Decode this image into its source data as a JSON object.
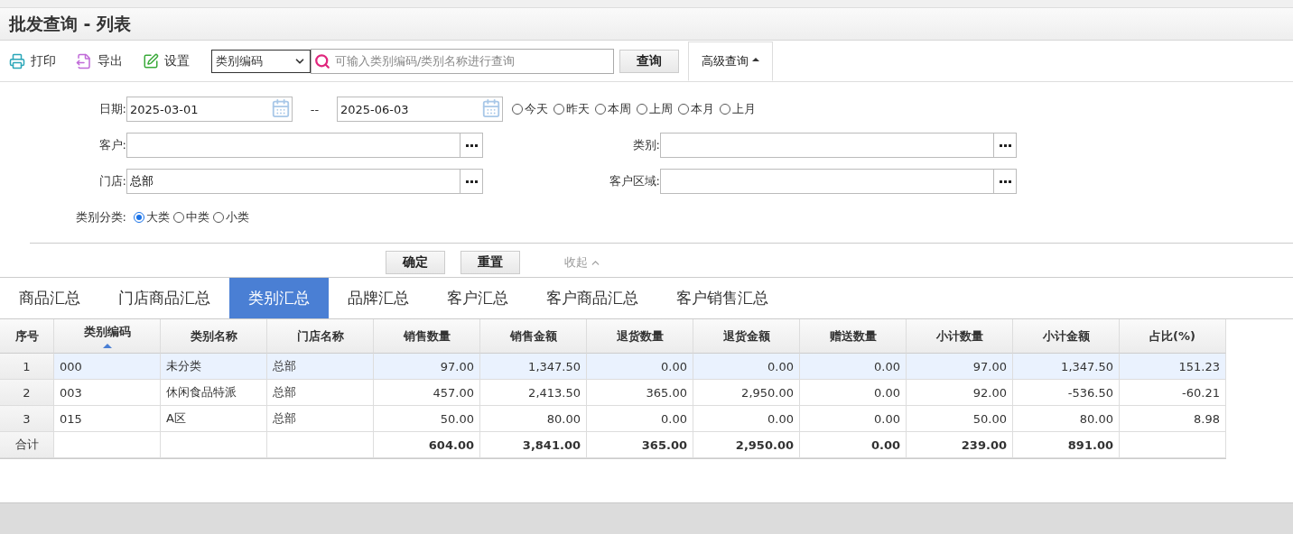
{
  "page_title": "批发查询 - 列表",
  "toolbar": {
    "buttons": [
      {
        "kind": "print",
        "label": "打印"
      },
      {
        "kind": "export",
        "label": "导出"
      },
      {
        "kind": "settings",
        "label": "设置"
      }
    ],
    "search_type": {
      "value": "类别编码"
    },
    "search": {
      "placeholder": "可输入类别编码/类别名称进行查询"
    },
    "query_button": "查询",
    "advanced": {
      "label": "高级查询",
      "expanded": true
    }
  },
  "filters": {
    "date": {
      "label": "日期:",
      "from": "2025-03-01",
      "separator": "--",
      "to": "2025-06-03",
      "presets": [
        {
          "label": "今天",
          "selected": false
        },
        {
          "label": "昨天",
          "selected": false
        },
        {
          "label": "本周",
          "selected": false
        },
        {
          "label": "上周",
          "selected": false
        },
        {
          "label": "本月",
          "selected": false
        },
        {
          "label": "上月",
          "selected": false
        }
      ]
    },
    "rows": [
      [
        {
          "label": "客户:"
        },
        {
          "label": "类别:"
        }
      ],
      [
        {
          "label": "门店:",
          "value": "总部"
        },
        {
          "label": "客户区域:"
        }
      ]
    ],
    "level": {
      "label": "类别分类:",
      "options": [
        {
          "label": "大类",
          "selected": true
        },
        {
          "label": "中类",
          "selected": false
        },
        {
          "label": "小类",
          "selected": false
        }
      ]
    },
    "buttons": [
      "确定",
      "重置"
    ],
    "collapse": "收起"
  },
  "tabs": [
    {
      "label": "商品汇总",
      "selected": false
    },
    {
      "label": "门店商品汇总",
      "selected": false
    },
    {
      "label": "类别汇总",
      "selected": true
    },
    {
      "label": "品牌汇总",
      "selected": false
    },
    {
      "label": "客户汇总",
      "selected": false
    },
    {
      "label": "客户商品汇总",
      "selected": false
    },
    {
      "label": "客户销售汇总",
      "selected": false
    }
  ],
  "table": {
    "columns": [
      {
        "label": "序号",
        "sorted": false
      },
      {
        "label": "类别编码",
        "sorted": true
      },
      {
        "label": "类别名称",
        "sorted": false
      },
      {
        "label": "门店名称",
        "sorted": false
      },
      {
        "label": "销售数量",
        "sorted": false
      },
      {
        "label": "销售金额",
        "sorted": false
      },
      {
        "label": "退货数量",
        "sorted": false
      },
      {
        "label": "退货金额",
        "sorted": false
      },
      {
        "label": "赠送数量",
        "sorted": false
      },
      {
        "label": "小计数量",
        "sorted": false
      },
      {
        "label": "小计金额",
        "sorted": false
      },
      {
        "label": "占比(%)",
        "sorted": false
      }
    ],
    "rows": [
      {
        "selected": true,
        "cells": [
          "1",
          "000",
          "未分类",
          "总部",
          "97.00",
          "1,347.50",
          "0.00",
          "0.00",
          "0.00",
          "97.00",
          "1,347.50",
          "151.23"
        ]
      },
      {
        "selected": false,
        "cells": [
          "2",
          "003",
          "休闲食品特派",
          "总部",
          "457.00",
          "2,413.50",
          "365.00",
          "2,950.00",
          "0.00",
          "92.00",
          "-536.50",
          "-60.21"
        ]
      },
      {
        "selected": false,
        "cells": [
          "3",
          "015",
          "A区",
          "总部",
          "50.00",
          "80.00",
          "0.00",
          "0.00",
          "0.00",
          "50.00",
          "80.00",
          "8.98"
        ]
      }
    ],
    "total": {
      "label": "合计",
      "values": [
        "604.00",
        "3,841.00",
        "365.00",
        "2,950.00",
        "0.00",
        "239.00",
        "891.00"
      ]
    }
  }
}
